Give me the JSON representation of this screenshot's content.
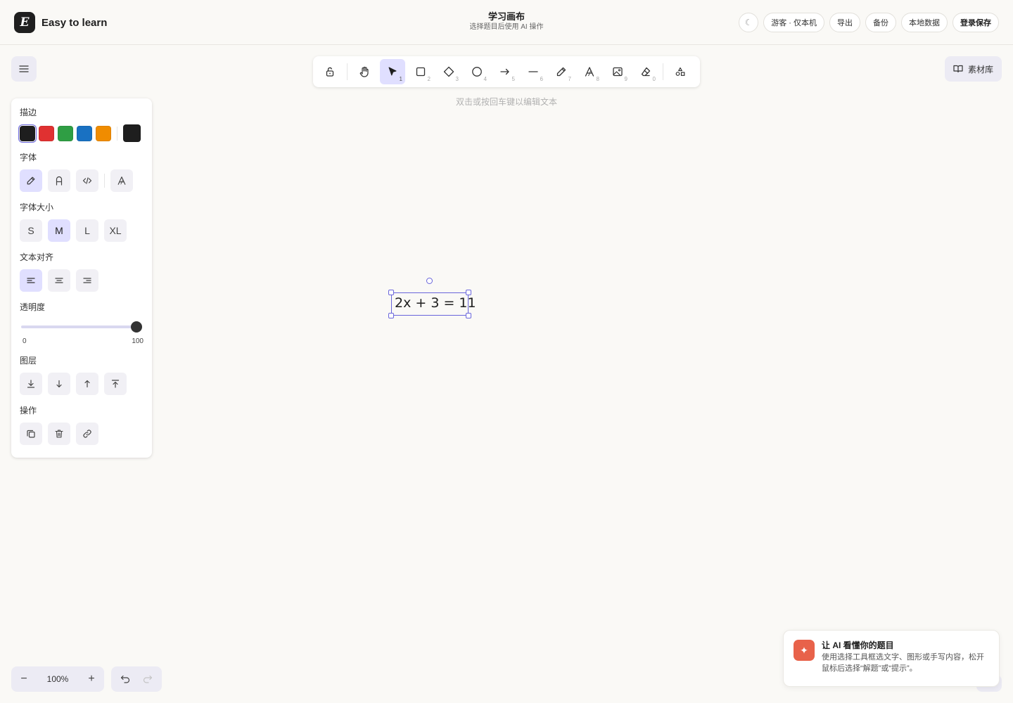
{
  "brand": {
    "logo_letter": "E",
    "name": "Easy to learn"
  },
  "header": {
    "title": "学习画布",
    "subtitle": "选择题目后使用 AI 操作",
    "theme_toggle": "☾",
    "guest_label": "游客 · 仅本机",
    "export_label": "导出",
    "backup_label": "备份",
    "local_data_label": "本地数据",
    "login_label": "登录保存"
  },
  "toolbar": {
    "tools": [
      {
        "name": "lock",
        "key": ""
      },
      {
        "name": "hand",
        "key": ""
      },
      {
        "name": "selection",
        "key": "1",
        "active": true
      },
      {
        "name": "rectangle",
        "key": "2"
      },
      {
        "name": "diamond",
        "key": "3"
      },
      {
        "name": "ellipse",
        "key": "4"
      },
      {
        "name": "arrow",
        "key": "5"
      },
      {
        "name": "line",
        "key": "6"
      },
      {
        "name": "draw",
        "key": "7"
      },
      {
        "name": "text",
        "key": "8"
      },
      {
        "name": "image",
        "key": "9"
      },
      {
        "name": "eraser",
        "key": "0"
      },
      {
        "name": "more-tools",
        "key": ""
      }
    ],
    "hint": "双击或按回车键以编辑文本"
  },
  "library_label": "素材库",
  "panel": {
    "stroke_title": "描边",
    "stroke_colors": [
      "#1e1e1e",
      "#e03131",
      "#2f9e44",
      "#1971c2",
      "#f08c00"
    ],
    "current_stroke": "#1e1e1e",
    "font_title": "字体",
    "font_size_title": "字体大小",
    "font_sizes": [
      "S",
      "M",
      "L",
      "XL"
    ],
    "selected_font_size": "M",
    "align_title": "文本对齐",
    "opacity_title": "透明度",
    "opacity_value": 100,
    "opacity_min": "0",
    "opacity_max": "100",
    "layers_title": "图层",
    "actions_title": "操作"
  },
  "canvas": {
    "selected_text": "2x + 3 = 11"
  },
  "zoom": {
    "value": "100%",
    "minus": "−",
    "plus": "+"
  },
  "ai_toast": {
    "icon": "✦",
    "title": "让 AI 看懂你的题目",
    "body": "使用选择工具框选文字、图形或手写内容，松开鼠标后选择“解题”或“提示”。"
  },
  "colors": {
    "accent": "#6965db",
    "accent_bg": "#e0dfff",
    "toast_icon_bg": "#e8624a"
  }
}
